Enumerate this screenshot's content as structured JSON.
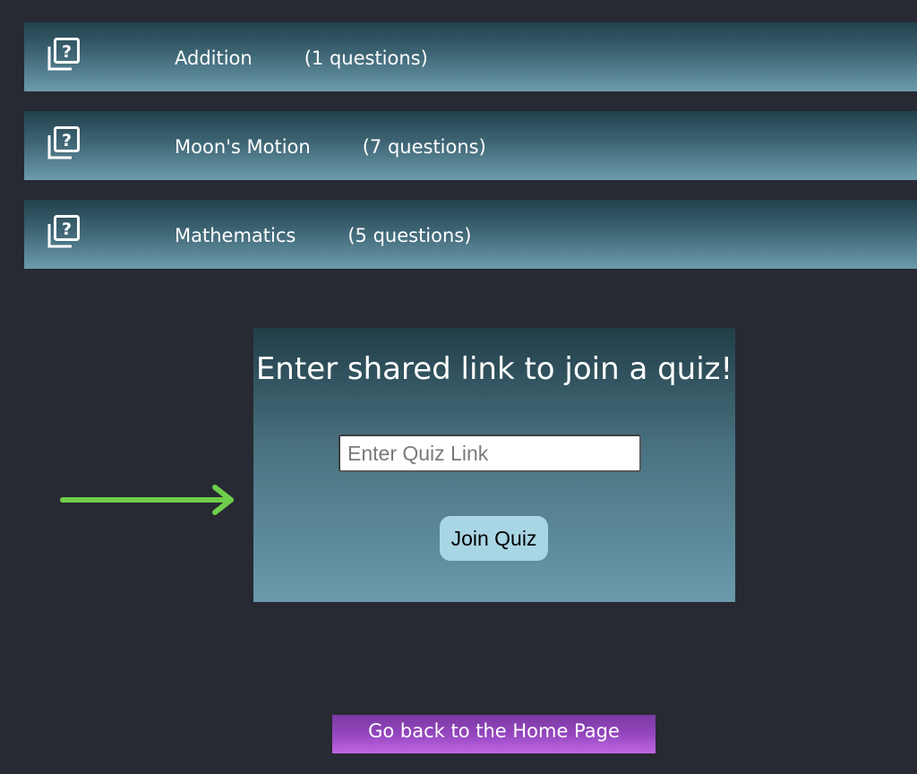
{
  "quizzes": [
    {
      "title": "Addition",
      "count": "(1 questions)",
      "icon": "quiz-question-icon"
    },
    {
      "title": "Moon's Motion",
      "count": "(7 questions)",
      "icon": "quiz-question-icon"
    },
    {
      "title": "Mathematics",
      "count": "(5 questions)",
      "icon": "quiz-question-icon"
    }
  ],
  "join": {
    "title": "Enter shared link to join a quiz!",
    "input_placeholder": "Enter Quiz Link",
    "input_value": "",
    "button_label": "Join Quiz"
  },
  "annotation": {
    "arrow_icon": "right-arrow-icon",
    "arrow_color": "#6fce4a"
  },
  "home_button": {
    "label": "Go back to the Home Page"
  },
  "colors": {
    "background": "#272a33",
    "row_gradient_top": "#22414d",
    "row_gradient_bottom": "#6c9cad",
    "join_button": "#a9d6e5",
    "home_button": "#9446be"
  }
}
